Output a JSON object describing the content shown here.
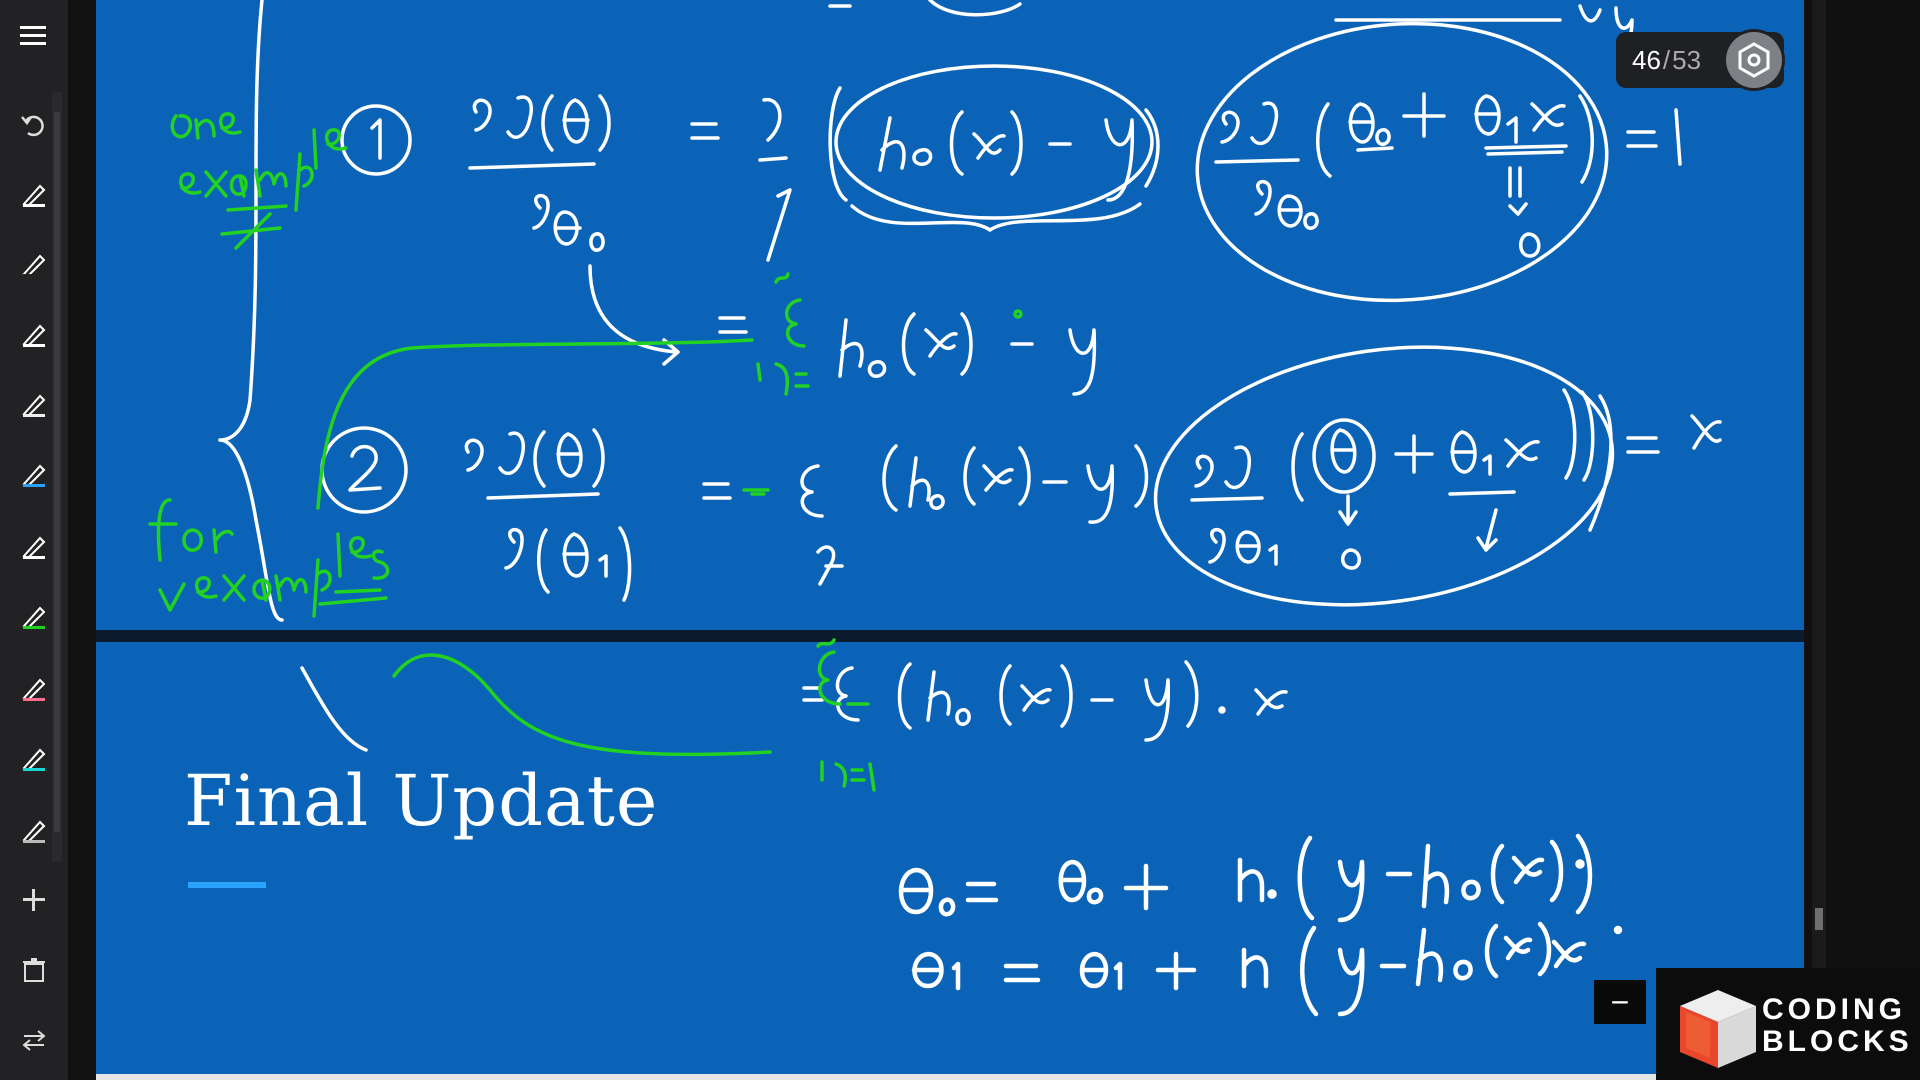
{
  "slide": {
    "title": "Final Update",
    "current_page": "46",
    "total_pages": "53"
  },
  "logo": {
    "line1": "CODING",
    "line2": "BLOCKS"
  },
  "toolbar": {
    "items": [
      "menu-icon",
      "undo-icon",
      "pen-1-icon",
      "pen-2-icon",
      "pen-3-icon",
      "pen-4-icon",
      "pen-5-icon",
      "pen-6-icon",
      "pen-7-icon",
      "pen-8-icon",
      "pen-9-icon",
      "pen-10-icon",
      "add-icon",
      "trash-icon",
      "swap-icon"
    ]
  },
  "colors": {
    "board": "#0a63b7",
    "ink_white": "#ffffff",
    "ink_green": "#22d122",
    "accent": "#2aa3ff"
  },
  "controls": {
    "minus_label": "−"
  }
}
